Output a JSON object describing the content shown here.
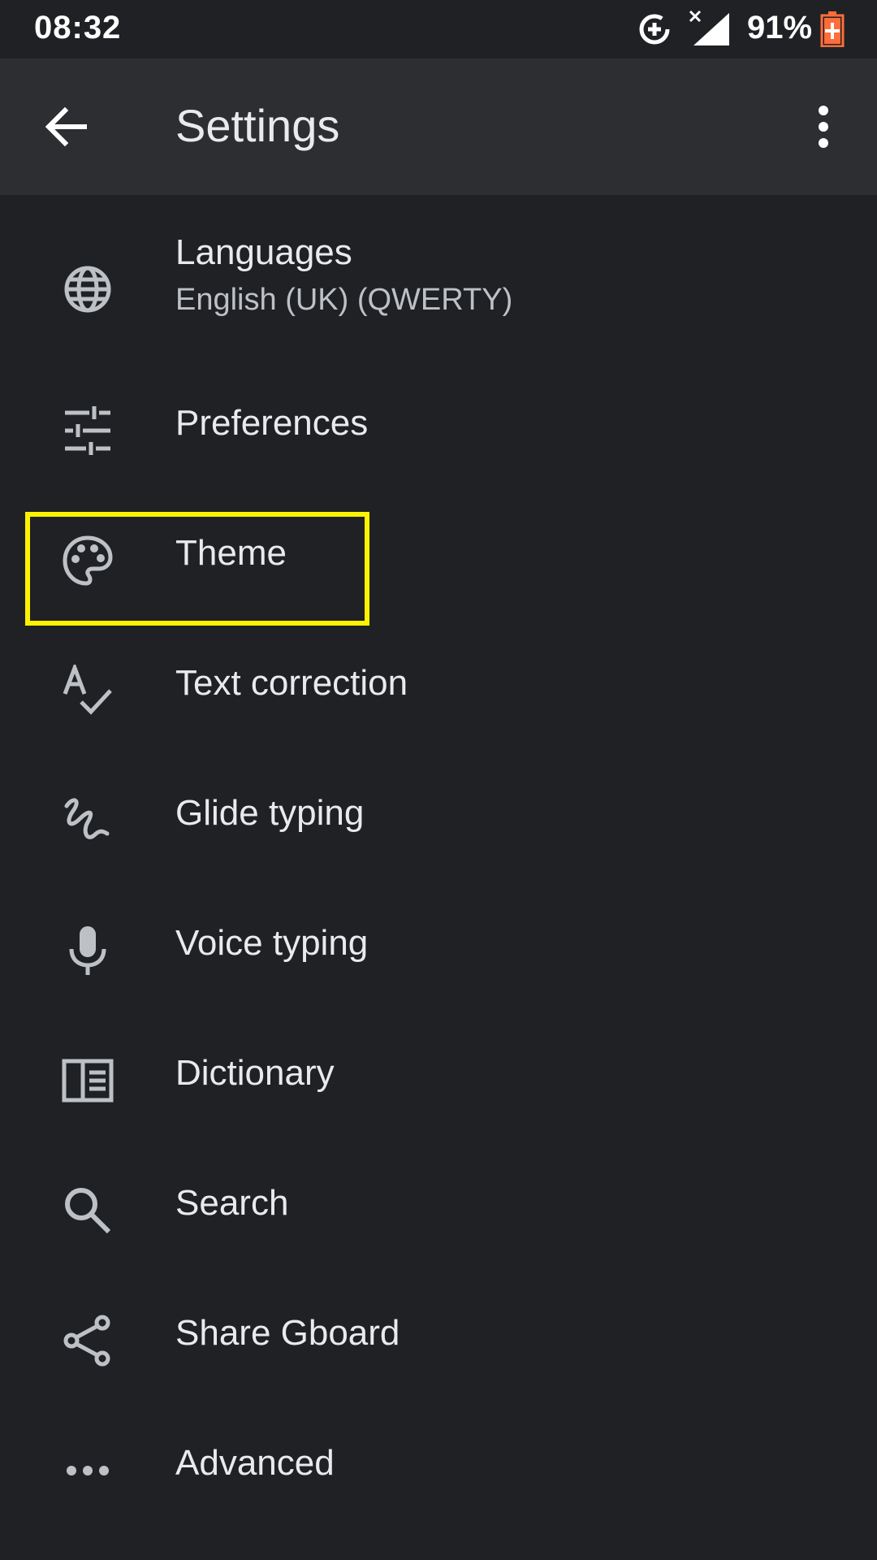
{
  "status_bar": {
    "time": "08:32",
    "battery_percent": "91%",
    "icons": [
      "data-saver-icon",
      "signal-no-data-icon",
      "battery-charging-icon"
    ]
  },
  "app_bar": {
    "title": "Settings",
    "back_icon": "arrow-back-icon",
    "more_icon": "more-vert-icon"
  },
  "settings": {
    "items": [
      {
        "label": "Languages",
        "subtitle": "English (UK) (QWERTY)",
        "icon": "globe-icon"
      },
      {
        "label": "Preferences",
        "icon": "tune-icon"
      },
      {
        "label": "Theme",
        "icon": "palette-icon"
      },
      {
        "label": "Text correction",
        "icon": "spellcheck-icon"
      },
      {
        "label": "Glide typing",
        "icon": "gesture-icon"
      },
      {
        "label": "Voice typing",
        "icon": "mic-icon"
      },
      {
        "label": "Dictionary",
        "icon": "dictionary-icon"
      },
      {
        "label": "Search",
        "icon": "search-icon"
      },
      {
        "label": "Share Gboard",
        "icon": "share-icon"
      },
      {
        "label": "Advanced",
        "icon": "more-horiz-icon"
      }
    ]
  },
  "colors": {
    "background": "#202124",
    "app_bar": "#2d2e31",
    "text_primary": "#e8eaed",
    "text_secondary": "#bdc1c6",
    "icon": "#bdc1c6",
    "highlight": "#fff200",
    "battery_accent": "#ff6d3a"
  }
}
